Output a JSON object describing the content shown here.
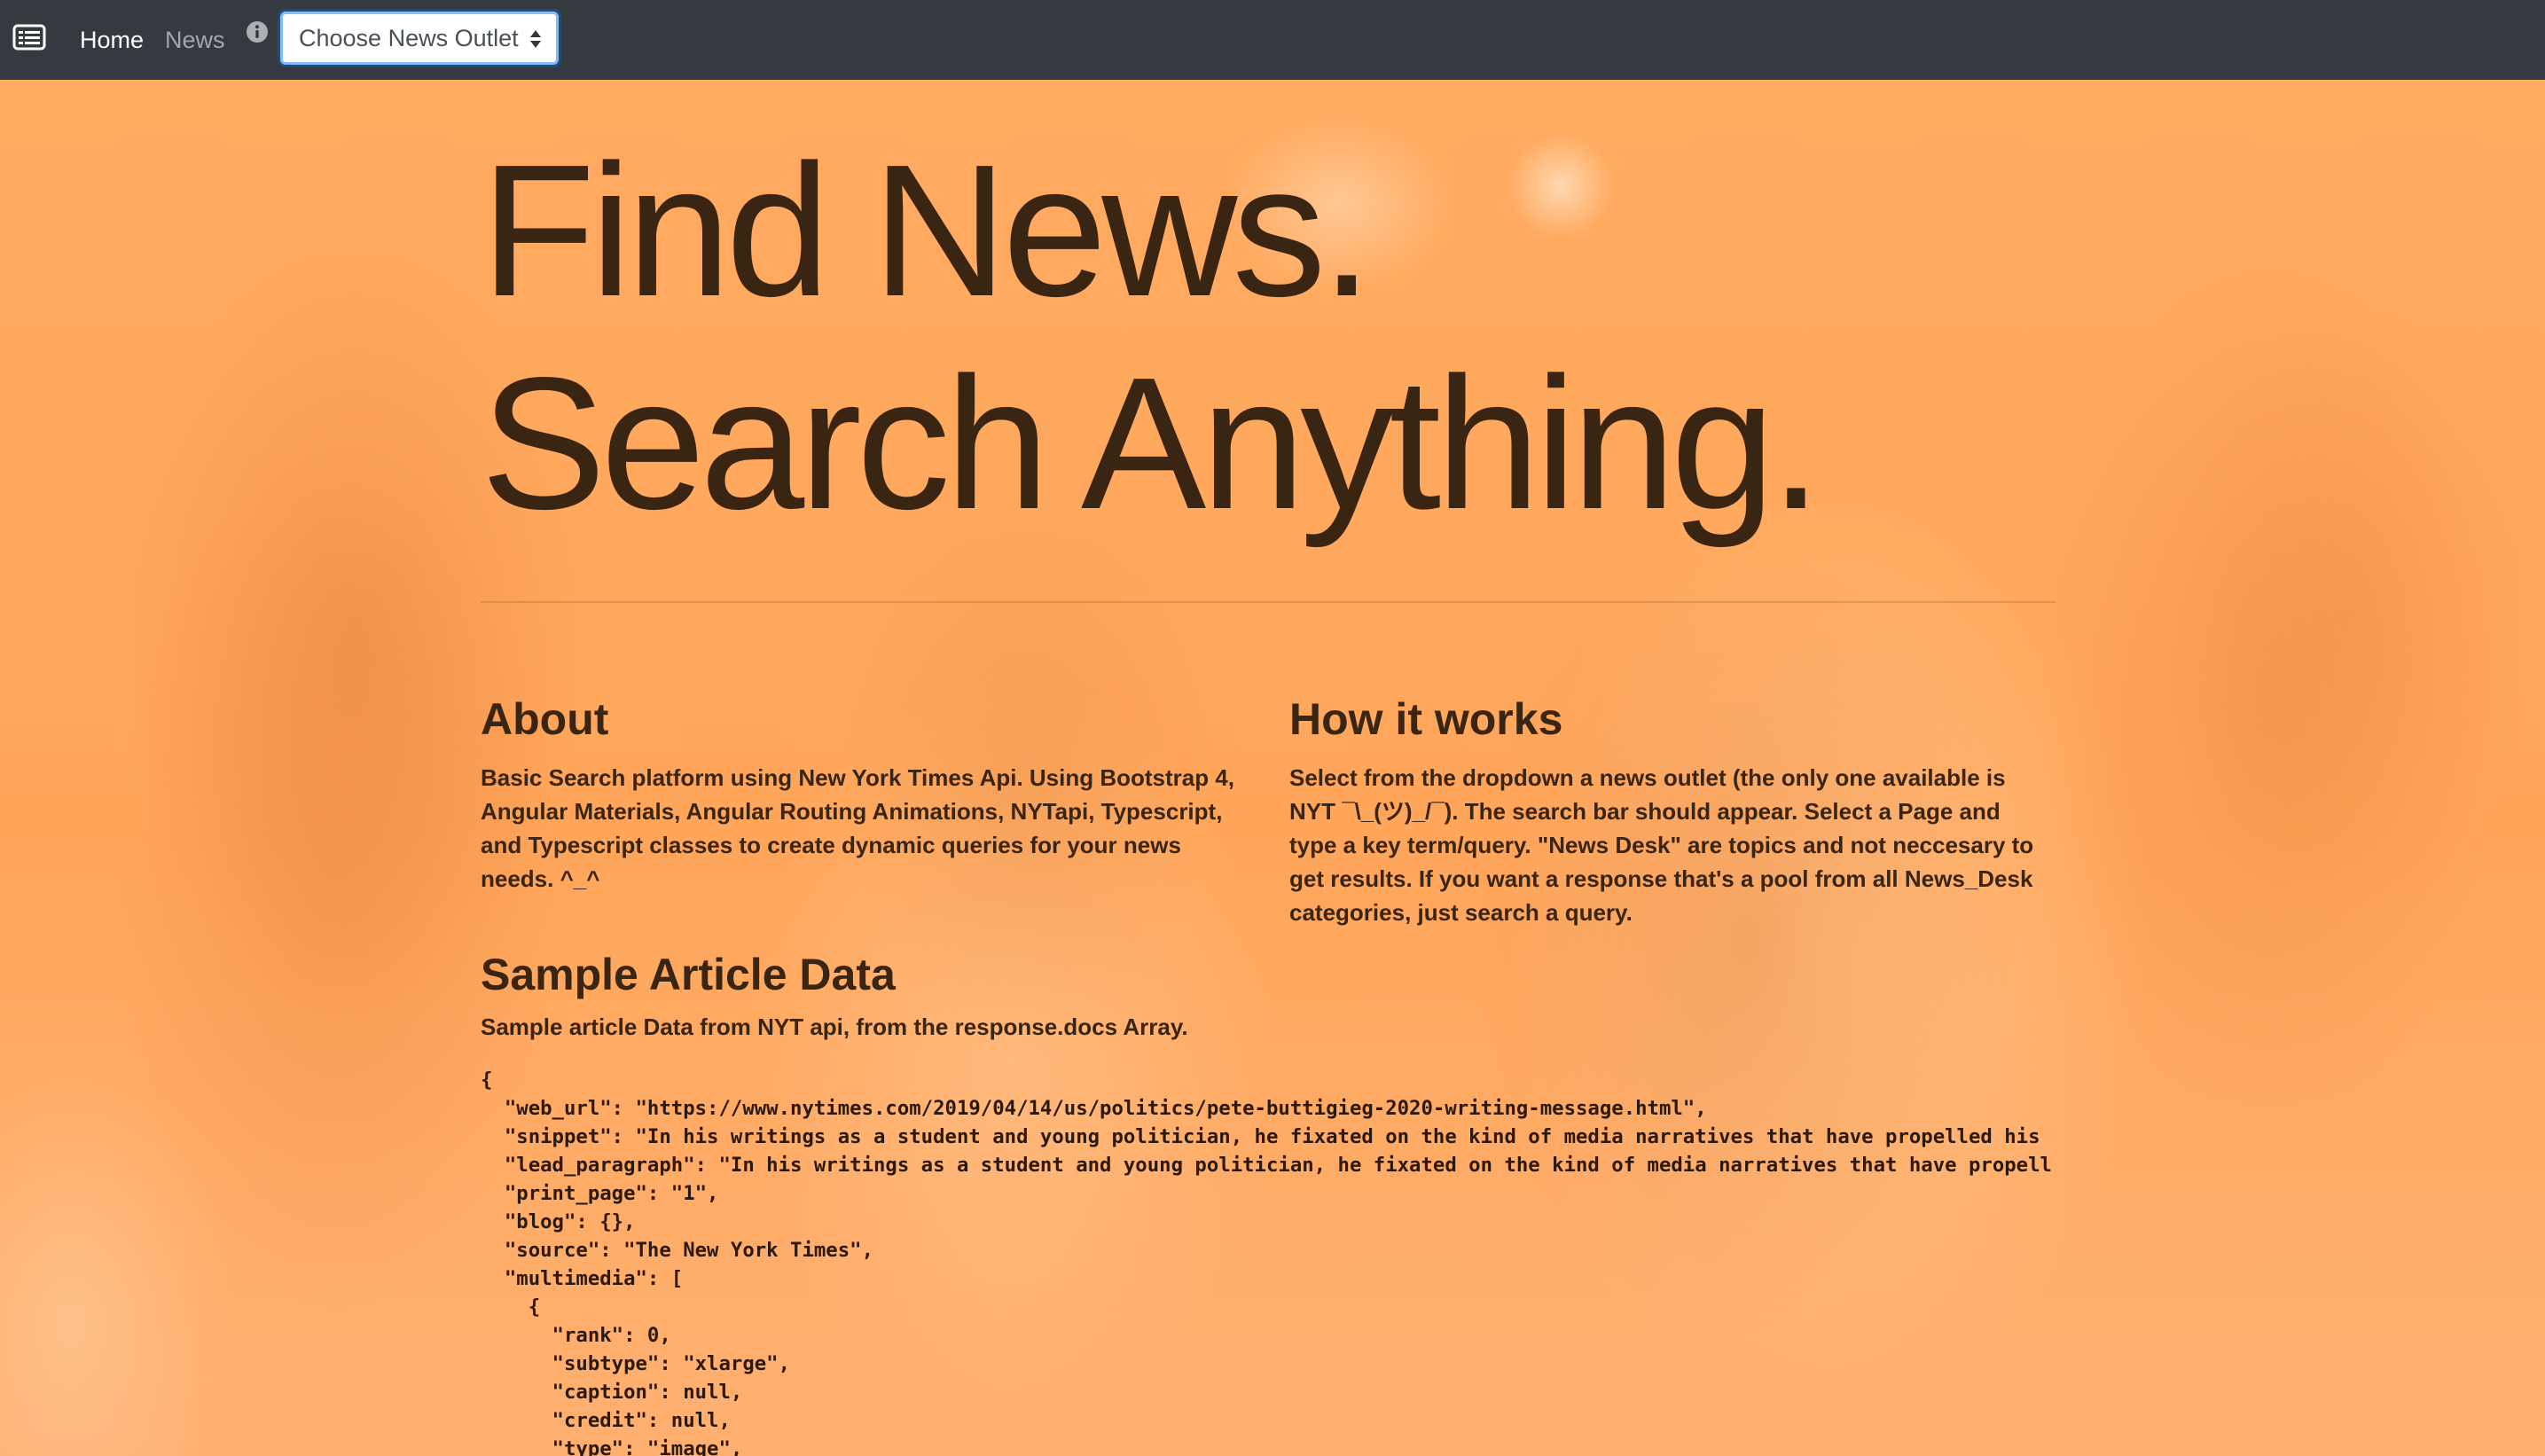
{
  "nav": {
    "home_label": "Home",
    "news_label": "News",
    "outlet_select_value": "Choose News Outlet",
    "icons": [
      "list-icon",
      "info-icon",
      "updown-caret-icon"
    ]
  },
  "hero": {
    "line1": "Find News.",
    "line2": "Search Anything."
  },
  "about": {
    "heading": "About",
    "body": "Basic Search platform using New York Times Api. Using Bootstrap 4, Angular Materials, Angular Routing Animations, NYTapi, Typescript, and Typescript classes to create dynamic queries for your news needs. ^_^"
  },
  "how_it_works": {
    "heading": "How it works",
    "body": "Select from the dropdown a news outlet (the only one available is NYT ¯\\_(ツ)_/¯). The search bar should appear. Select a Page and type a key term/query. \"News Desk\" are topics and not neccesary to get results. If you want a response that's a pool from all News_Desk categories, just search a query."
  },
  "sample": {
    "heading": "Sample Article Data",
    "description": "Sample article Data from NYT api, from the response.docs Array.",
    "code": "{\n  \"web_url\": \"https://www.nytimes.com/2019/04/14/us/politics/pete-buttigieg-2020-writing-message.html\",\n  \"snippet\": \"In his writings as a student and young politician, he fixated on the kind of media narratives that have propelled his\n  \"lead_paragraph\": \"In his writings as a student and young politician, he fixated on the kind of media narratives that have propell\n  \"print_page\": \"1\",\n  \"blog\": {},\n  \"source\": \"The New York Times\",\n  \"multimedia\": [\n    {\n      \"rank\": 0,\n      \"subtype\": \"xlarge\",\n      \"caption\": null,\n      \"credit\": null,\n      \"type\": \"image\","
  },
  "colors": {
    "navbar": "#343a40",
    "background_tint": "#ffa75a",
    "text_dark": "#3a2513",
    "select_focus": "#80bdff"
  }
}
